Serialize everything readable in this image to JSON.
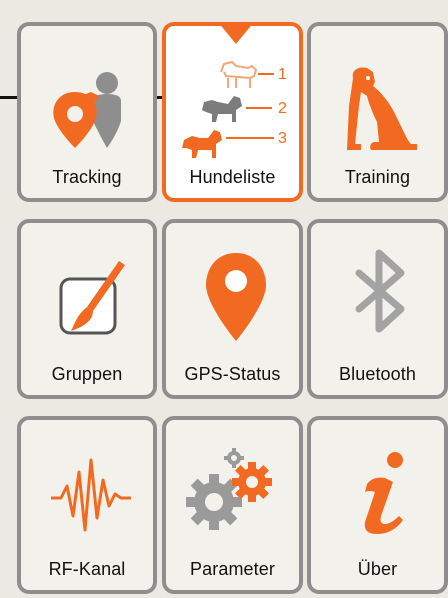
{
  "accent_color": "#f26a21",
  "tiles": [
    {
      "id": "tracking",
      "label": "Tracking",
      "icon": "tracking-icon",
      "selected": false
    },
    {
      "id": "hundeliste",
      "label": "Hundeliste",
      "icon": "dog-list-icon",
      "selected": true,
      "list_numbers": [
        "1",
        "2",
        "3"
      ]
    },
    {
      "id": "training",
      "label": "Training",
      "icon": "dog-sitting-icon",
      "selected": false
    },
    {
      "id": "gruppen",
      "label": "Gruppen",
      "icon": "paint-brush-icon",
      "selected": false
    },
    {
      "id": "gps_status",
      "label": "GPS-Status",
      "icon": "map-pin-icon",
      "selected": false
    },
    {
      "id": "bluetooth",
      "label": "Bluetooth",
      "icon": "bluetooth-icon",
      "selected": false
    },
    {
      "id": "rf_kanal",
      "label": "RF-Kanal",
      "icon": "rf-wave-icon",
      "selected": false
    },
    {
      "id": "parameter",
      "label": "Parameter",
      "icon": "gears-icon",
      "selected": false
    },
    {
      "id": "ueber",
      "label": "Über",
      "icon": "info-icon",
      "selected": false
    }
  ]
}
